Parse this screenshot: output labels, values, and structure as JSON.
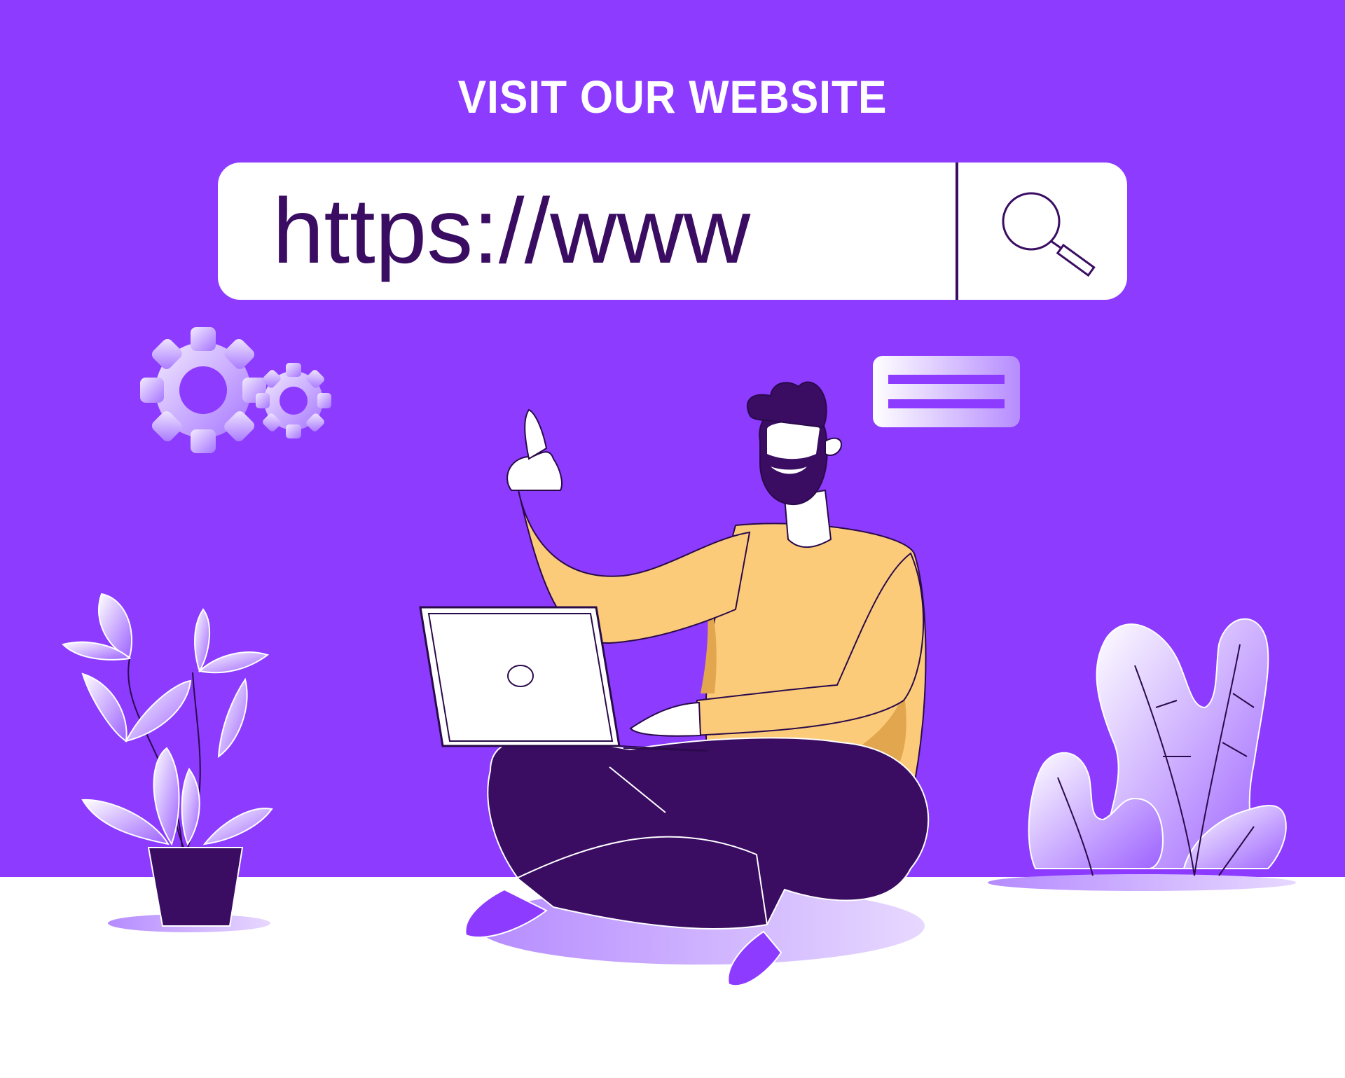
{
  "banner": {
    "headline": "VISIT OUR WEBSITE"
  },
  "search": {
    "placeholder": "https://www",
    "button_icon": "search-icon"
  },
  "colors": {
    "background": "#8c3bff",
    "floor": "#ffffff",
    "dark_purple": "#3a0d63",
    "sweater": "#fbcb7a",
    "sweater_shade": "#e2a64f",
    "lavender": "#d9c2ff",
    "shoes": "#8c3bff"
  },
  "decorations": {
    "gears_icon": "gears-icon",
    "chat_bubble_icon": "chat-bubble-icon",
    "left_plant": "potted-plant",
    "right_plant": "bush"
  }
}
